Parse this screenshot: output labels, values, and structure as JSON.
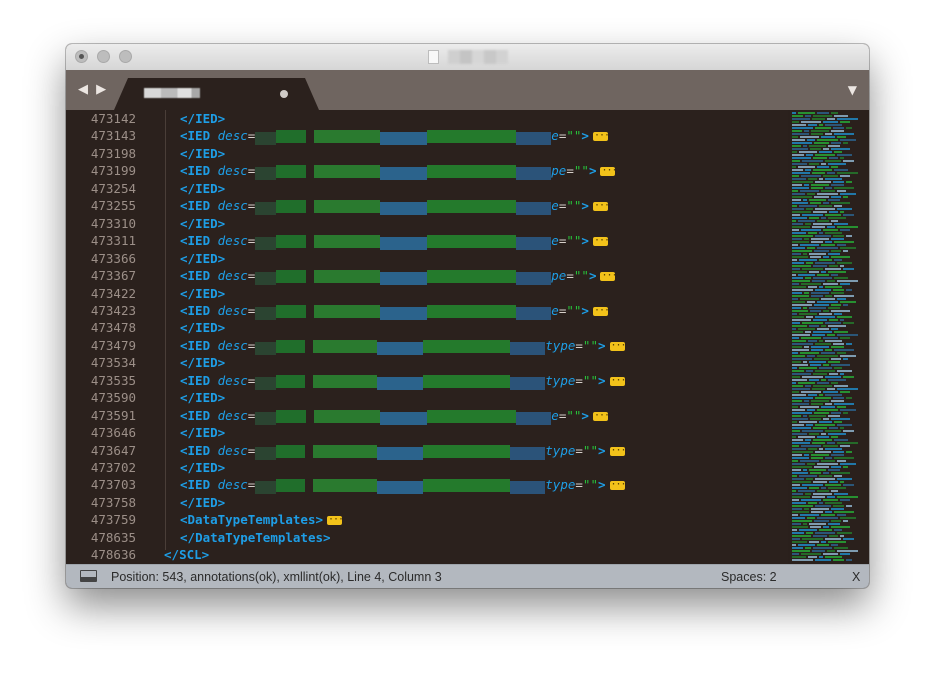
{
  "editor": {
    "lines": [
      {
        "num": "473142",
        "indent": 1,
        "kind": "close",
        "tag": "IED"
      },
      {
        "num": "473143",
        "indent": 1,
        "kind": "open",
        "tag": "IED",
        "attr": "desc",
        "tail_attr": "e",
        "tail_value": "\"\"",
        "blur_width": 296
      },
      {
        "num": "473198",
        "indent": 1,
        "kind": "close",
        "tag": "IED"
      },
      {
        "num": "473199",
        "indent": 1,
        "kind": "open",
        "tag": "IED",
        "attr": "desc",
        "tail_attr": "pe",
        "tail_value": "\"\"",
        "blur_width": 296
      },
      {
        "num": "473254",
        "indent": 1,
        "kind": "close",
        "tag": "IED"
      },
      {
        "num": "473255",
        "indent": 1,
        "kind": "open",
        "tag": "IED",
        "attr": "desc",
        "tail_attr": "e",
        "tail_value": "\"\"",
        "blur_width": 296
      },
      {
        "num": "473310",
        "indent": 1,
        "kind": "close",
        "tag": "IED"
      },
      {
        "num": "473311",
        "indent": 1,
        "kind": "open",
        "tag": "IED",
        "attr": "desc",
        "tail_attr": "e",
        "tail_value": "\"\"",
        "blur_width": 296
      },
      {
        "num": "473366",
        "indent": 1,
        "kind": "close",
        "tag": "IED"
      },
      {
        "num": "473367",
        "indent": 1,
        "kind": "open",
        "tag": "IED",
        "attr": "desc",
        "tail_attr": "pe",
        "tail_value": "\"\"",
        "blur_width": 296
      },
      {
        "num": "473422",
        "indent": 1,
        "kind": "close",
        "tag": "IED"
      },
      {
        "num": "473423",
        "indent": 1,
        "kind": "open",
        "tag": "IED",
        "attr": "desc",
        "tail_attr": "e",
        "tail_value": "\"\"",
        "blur_width": 296
      },
      {
        "num": "473478",
        "indent": 1,
        "kind": "close",
        "tag": "IED"
      },
      {
        "num": "473479",
        "indent": 1,
        "kind": "open",
        "tag": "IED",
        "attr": "desc",
        "tail_attr": "type",
        "tail_value": "\"\"",
        "blur_width": 290
      },
      {
        "num": "473534",
        "indent": 1,
        "kind": "close",
        "tag": "IED"
      },
      {
        "num": "473535",
        "indent": 1,
        "kind": "open",
        "tag": "IED",
        "attr": "desc",
        "tail_attr": "type",
        "tail_value": "\"\"",
        "blur_width": 290
      },
      {
        "num": "473590",
        "indent": 1,
        "kind": "close",
        "tag": "IED"
      },
      {
        "num": "473591",
        "indent": 1,
        "kind": "open",
        "tag": "IED",
        "attr": "desc",
        "tail_attr": "e",
        "tail_value": "\"\"",
        "blur_width": 296
      },
      {
        "num": "473646",
        "indent": 1,
        "kind": "close",
        "tag": "IED"
      },
      {
        "num": "473647",
        "indent": 1,
        "kind": "open",
        "tag": "IED",
        "attr": "desc",
        "tail_attr": "type",
        "tail_value": "\"\"",
        "blur_width": 290
      },
      {
        "num": "473702",
        "indent": 1,
        "kind": "close",
        "tag": "IED"
      },
      {
        "num": "473703",
        "indent": 1,
        "kind": "open",
        "tag": "IED",
        "attr": "desc",
        "tail_attr": "type",
        "tail_value": "\"\"",
        "blur_width": 290
      },
      {
        "num": "473758",
        "indent": 1,
        "kind": "close",
        "tag": "IED"
      },
      {
        "num": "473759",
        "indent": 1,
        "kind": "open-plain",
        "tag": "DataTypeTemplates"
      },
      {
        "num": "478635",
        "indent": 1,
        "kind": "close",
        "tag": "DataTypeTemplates"
      },
      {
        "num": "478636",
        "indent": 0,
        "kind": "close",
        "tag": "SCL"
      }
    ]
  },
  "status": {
    "position_text": "Position:  543, annotations(ok), xmllint(ok), Line 4, Column 3",
    "spaces": "Spaces: 2",
    "syntax": "X"
  },
  "tabbar": {
    "nav_arrows": "◀ ▶",
    "menu_arrow": "▼"
  },
  "colors": {
    "background": "#2b211d",
    "tag": "#1e9ee6",
    "string": "#27c13a",
    "line_number": "#9c8f88",
    "fold_marker": "#f2c21a",
    "status_bar": "#b3b8bf"
  }
}
